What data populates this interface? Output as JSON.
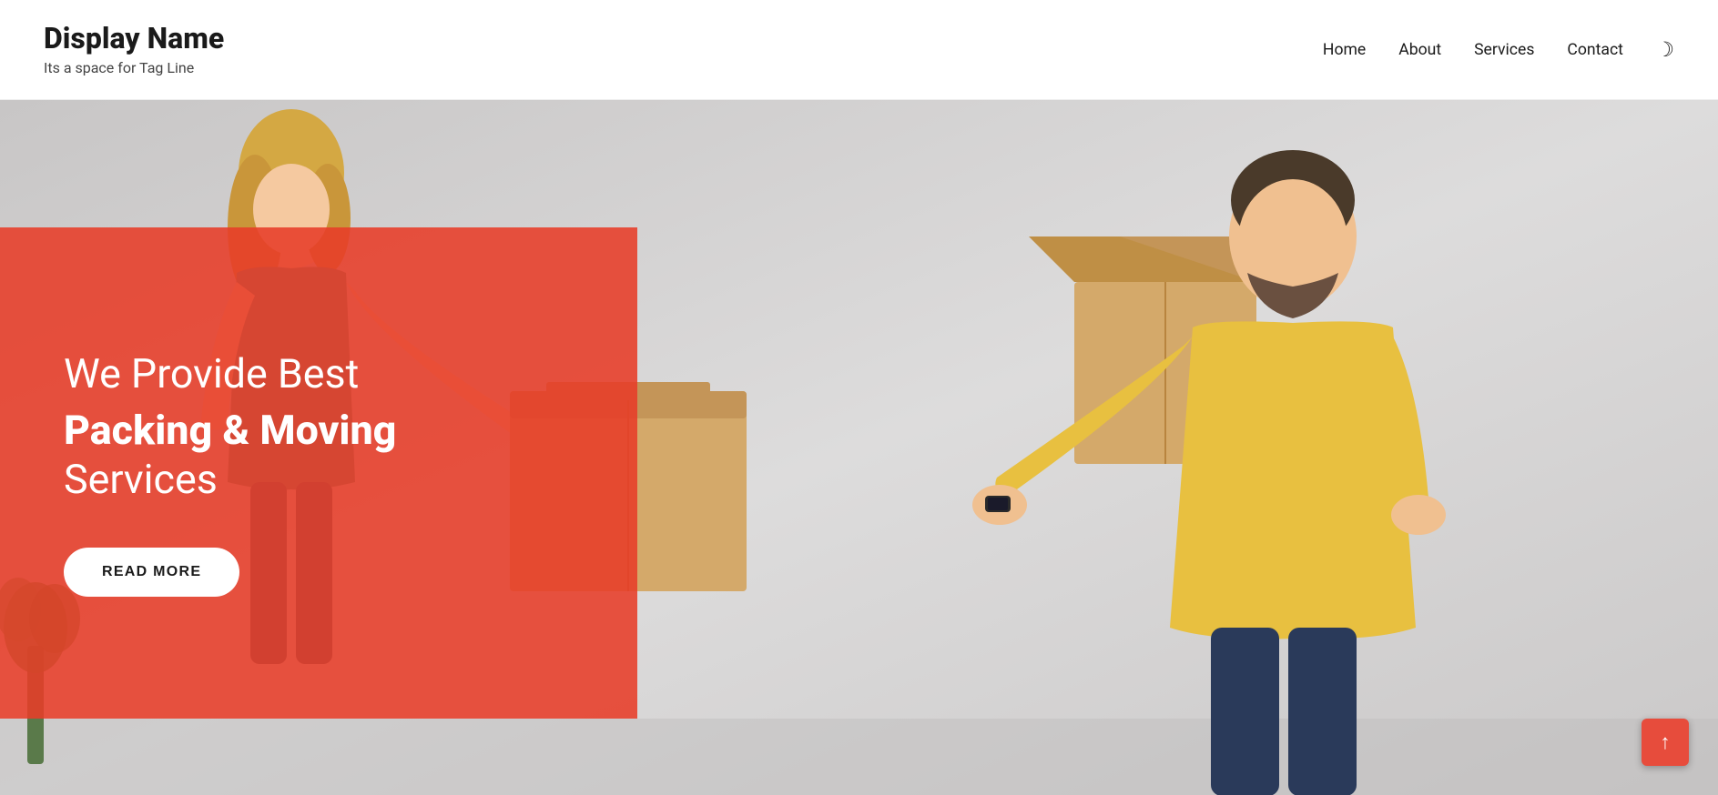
{
  "header": {
    "brand_name": "Display Name",
    "tagline": "Its a space for Tag Line",
    "nav": {
      "home_label": "Home",
      "about_label": "About",
      "services_label": "Services",
      "contact_label": "Contact"
    },
    "dark_mode_icon": "☽"
  },
  "hero": {
    "text_line1": "We Provide Best",
    "text_line2": "Packing & Moving",
    "text_line3": "Services",
    "cta_button": "READ MORE",
    "overlay_color": "#e74c3c"
  },
  "scroll_top": {
    "icon": "↑"
  }
}
